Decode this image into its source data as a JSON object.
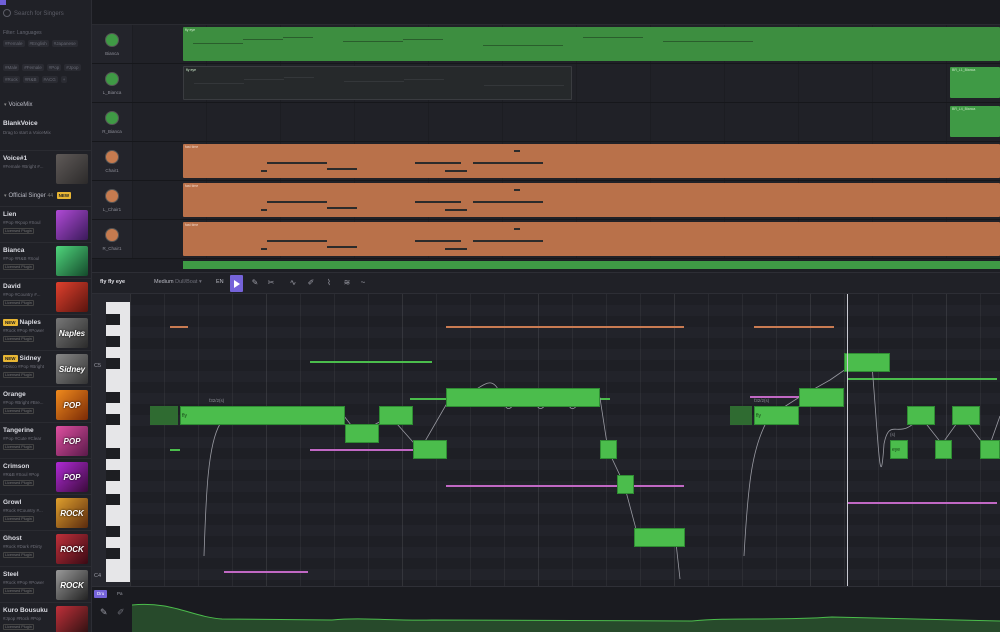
{
  "sidebar": {
    "search_placeholder": "Search for Singers",
    "filter_label": "Filter: Languages",
    "tag_rows": [
      [
        "#Female",
        "#English",
        "#Japanese"
      ],
      [
        "#Male",
        "#Female",
        "#Pop",
        "#Jpop"
      ],
      [
        "#Rock",
        "#R&B",
        "#ACG",
        "+"
      ]
    ],
    "voicemix": {
      "label": "VoiceMix",
      "blank_title": "BlankVoice",
      "blank_sub": "Drag to start a VoiceMix"
    },
    "voice1": {
      "name": "Voice#1",
      "tags": "#Female #Bright #..."
    },
    "official_label": "Official Singer",
    "official_count": "44",
    "new_badge": "NEW",
    "license_label": "Licensed Plugin",
    "singers": [
      {
        "name": "Lien",
        "tags": "#Pop #Kpop #Soul",
        "thumb": "",
        "new": false
      },
      {
        "name": "Bianca",
        "tags": "#Pop #R&B #Soul",
        "thumb": "",
        "new": false
      },
      {
        "name": "David",
        "tags": "#Pop #Country #...",
        "thumb": "",
        "new": false
      },
      {
        "name": "Naples",
        "tags": "#Rock #Pop #Power",
        "thumb": "Naples",
        "new": true
      },
      {
        "name": "Sidney",
        "tags": "#Disco #Pop #Bright",
        "thumb": "Sidney",
        "new": true
      },
      {
        "name": "Orange",
        "tags": "#Pop #Bright #Bre...",
        "thumb": "POP",
        "new": false
      },
      {
        "name": "Tangerine",
        "tags": "#Pop #Cute #Clear",
        "thumb": "POP",
        "new": false
      },
      {
        "name": "Crimson",
        "tags": "#R&B #Soul #Pop",
        "thumb": "POP",
        "new": false
      },
      {
        "name": "Growl",
        "tags": "#Rock #Country #...",
        "thumb": "ROCK",
        "new": false
      },
      {
        "name": "Ghost",
        "tags": "#Rock #Dark #Dirty",
        "thumb": "ROCK",
        "new": false
      },
      {
        "name": "Steel",
        "tags": "#Rock #Pop #Power",
        "thumb": "ROCK",
        "new": false
      },
      {
        "name": "Kuro Bousuku",
        "tags": "#Jpop #Rock #Pop",
        "thumb": "",
        "new": false
      }
    ]
  },
  "tracks": [
    {
      "name": "Bianca",
      "color": "#3f9a45",
      "region_label": "fly eye",
      "region2_label": "Bianca"
    },
    {
      "name": "L_Bianca",
      "color": "#3f9a45",
      "region_label": "fly eye",
      "region2_label": "BR_L1_Bianca"
    },
    {
      "name": "R_Bianca",
      "color": "#3f9a45",
      "region_label": "",
      "region2_label": "BR_L4_Bianca"
    },
    {
      "name": "Chair1",
      "color": "#c67b4f",
      "region_label": "fast time"
    },
    {
      "name": "L_Chair1",
      "color": "#c67b4f",
      "region_label": "fast time"
    },
    {
      "name": "R_Chair1",
      "color": "#c67b4f",
      "region_label": "fast time"
    }
  ],
  "editor": {
    "lyric_title": "fly fly eye",
    "tempo_mode": "Medium",
    "mode_detail": "Dull/Boat",
    "language": "EN",
    "key_c5": "C5",
    "key_c4": "C4",
    "note_labels": [
      "fly",
      "fly",
      "eye"
    ],
    "pitch_tags": [
      "f32/2(s)",
      "f32/2(s)",
      "(s)"
    ]
  },
  "params": {
    "tab1": "Dru",
    "tab2": "Pa"
  },
  "colors": {
    "accent": "#7563d9",
    "note_green": "#4bbd4c",
    "track_green": "#3f9a45",
    "track_orange": "#c67b4f",
    "ref_pink": "#c168c4",
    "ref_orange": "#c97b52"
  }
}
